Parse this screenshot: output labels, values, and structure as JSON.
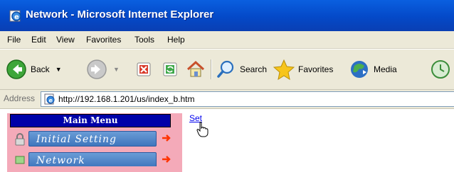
{
  "window": {
    "title": "Network - Microsoft Internet Explorer",
    "icon": "ie-page-icon"
  },
  "menubar": {
    "items": [
      "File",
      "Edit",
      "View",
      "Favorites",
      "Tools",
      "Help"
    ]
  },
  "toolbar": {
    "back_label": "Back",
    "search_label": "Search",
    "favorites_label": "Favorites",
    "media_label": "Media"
  },
  "address": {
    "label": "Address",
    "url": "http://192.168.1.201/us/index_b.htm"
  },
  "left_menu": {
    "header": "Main Menu",
    "items": [
      {
        "label": "Initial Setting"
      },
      {
        "label": "Network"
      }
    ]
  },
  "main": {
    "set_link": "Set"
  },
  "colors": {
    "titlebar": "#0449c8",
    "chrome": "#ece9d8",
    "menu_panel": "#f4aab9",
    "menu_header": "#0000a8",
    "menu_button": "#4f86c8",
    "arrow": "#ff3300",
    "link": "#0000ee"
  }
}
